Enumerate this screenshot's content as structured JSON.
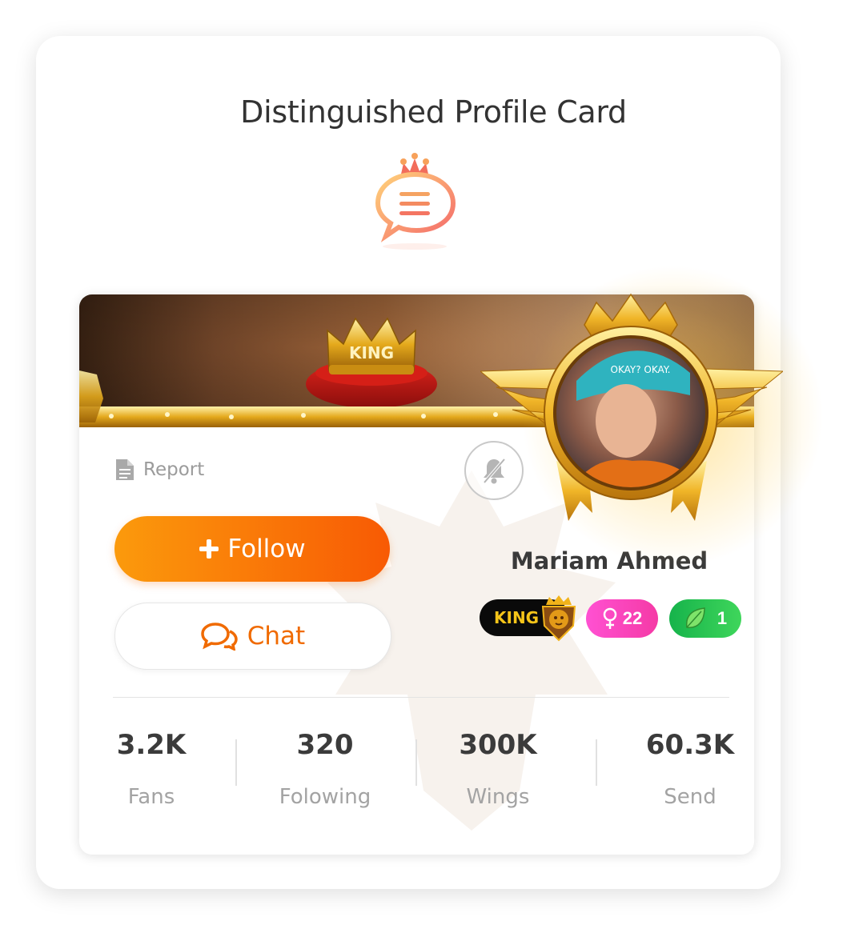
{
  "page": {
    "title": "Distinguished Profile Card"
  },
  "profile": {
    "name": "Mariam Ahmed",
    "report_label": "Report",
    "follow_label": "Follow",
    "chat_label": "Chat",
    "badges": {
      "king": "KING",
      "gender_age": "22",
      "leaf_level": "1"
    },
    "banner_crown_text": "KING",
    "avatar_cap_text": "OKAY? OKAY."
  },
  "stats": [
    {
      "value": "3.2K",
      "label": "Fans"
    },
    {
      "value": "320",
      "label": "Folowing"
    },
    {
      "value": "300K",
      "label": "Wings"
    },
    {
      "value": "60.3K",
      "label": "Send"
    }
  ],
  "colors": {
    "follow_gradient_start": "#fb9a0c",
    "follow_gradient_end": "#f85a04",
    "chat_text": "#f06a00",
    "gender_badge": "#ff51d2",
    "leaf_badge": "#16b34b",
    "king_badge_bg": "#0a0a0a",
    "king_badge_text": "#f5c419",
    "gold": "#e0a21a"
  },
  "icons": {
    "logo": "crown-chat-icon",
    "report": "document-icon",
    "mute": "bell-off-icon",
    "follow": "plus-icon",
    "chat": "chat-bubbles-icon",
    "gender": "female-icon",
    "leaf": "leaf-icon",
    "king": "lion-crest-icon"
  }
}
